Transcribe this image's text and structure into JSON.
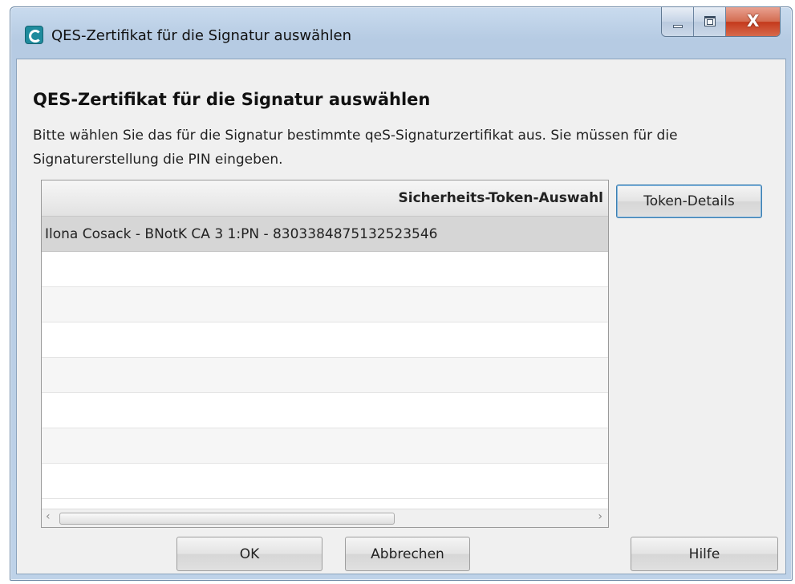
{
  "window": {
    "title": "QES-Zertifikat für die Signatur auswählen",
    "close_glyph": "X"
  },
  "dialog": {
    "heading": "QES-Zertifikat für die Signatur auswählen",
    "description": "Bitte wählen Sie das für die Signatur bestimmte qeS-Signaturzertifikat aus. Sie müssen für die Signaturerstellung die PIN eingeben."
  },
  "table": {
    "column_header": "Sicherheits-Token-Auswahl",
    "rows": [
      "Ilona Cosack - BNotK CA 3 1:PN - 8303384875132523546",
      "",
      "",
      "",
      "",
      "",
      "",
      ""
    ],
    "selected_row": 0
  },
  "buttons": {
    "token_details": "Token-Details",
    "ok": "OK",
    "cancel": "Abbrechen",
    "help": "Hilfe"
  },
  "icons": {
    "app": "app-logo-icon",
    "minimize": "minimize-icon",
    "maximize": "maximize-icon",
    "close": "close-icon",
    "scroll_left": "chevron-left-icon",
    "scroll_right": "chevron-right-icon"
  }
}
